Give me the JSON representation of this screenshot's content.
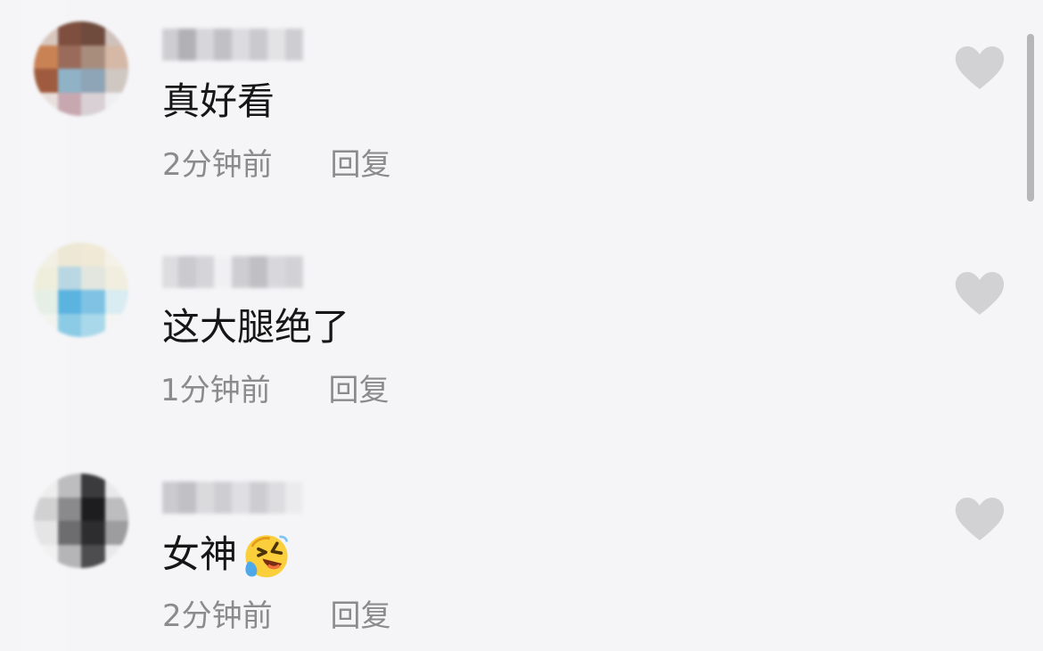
{
  "comments": [
    {
      "text": "真好看",
      "time": "2分钟前",
      "reply_label": "回复",
      "avatar_pixels": [
        "#d8c7be",
        "#7e4f3f",
        "#6e4b3d",
        "#cfc1bb",
        "#c98254",
        "#9a6b5a",
        "#a88d7d",
        "#d6b8a7",
        "#9f5b3d",
        "#8fb2c7",
        "#8ea4b7",
        "#cfc7c2",
        "#e8e0dd",
        "#c7a8b0",
        "#d8d0d4",
        "#efeff1"
      ],
      "username_pixels": [
        "#c8c8cc",
        "#a6a6aa",
        "#d2d2d6",
        "#b9b9bd",
        "#d8d8dc",
        "#c3c3c7",
        "#e0e0e3",
        "#c8c8cc"
      ]
    },
    {
      "text": "这大腿绝了",
      "time": "1分钟前",
      "reply_label": "回复",
      "avatar_pixels": [
        "#f2efe5",
        "#ece8d5",
        "#efe9d6",
        "#f4f1e8",
        "#efeedd",
        "#b9d7e3",
        "#e2e6df",
        "#f1eedf",
        "#e6efe6",
        "#5bb3e0",
        "#7fc2e4",
        "#d8ecf2",
        "#f2f3ef",
        "#8ccbe5",
        "#a9d8ea",
        "#f4f4f2"
      ],
      "username_pixels": [
        "#d9d9dc",
        "#c4c4c8",
        "#d0d0d4",
        "#f0f0f2",
        "#c8c8cc",
        "#b7b7bb",
        "#d4d4d8",
        "#cdcdd1"
      ]
    },
    {
      "text": "女神",
      "time": "2分钟前",
      "reply_label": "回复",
      "emoji": "😂",
      "avatar_pixels": [
        "#ededee",
        "#bdbdbf",
        "#3b3b3d",
        "#e9e9ea",
        "#d1d1d2",
        "#8a8a8c",
        "#1d1d1f",
        "#bdbdbf",
        "#e5e5e6",
        "#6d6d6f",
        "#2d2d2f",
        "#9d9d9f",
        "#f1f1f2",
        "#b5b5b7",
        "#4d4d4f",
        "#e9e9ea"
      ],
      "username_pixels": [
        "#c4c4c8",
        "#b8b8bc",
        "#d6d6d9",
        "#c8c8cc",
        "#dcdce0",
        "#c7c7cb",
        "#d9d9dc",
        "#eaeaed"
      ]
    }
  ],
  "colors": {
    "background": "#f5f5f7",
    "comment_text": "#161616",
    "meta_text": "#8b8b8d",
    "heart": "#d2d2d4",
    "scrollbar": "#b7b7ba"
  },
  "icons": {
    "like": "heart-outline-icon",
    "emoji": "laughing-tears-emoji"
  }
}
